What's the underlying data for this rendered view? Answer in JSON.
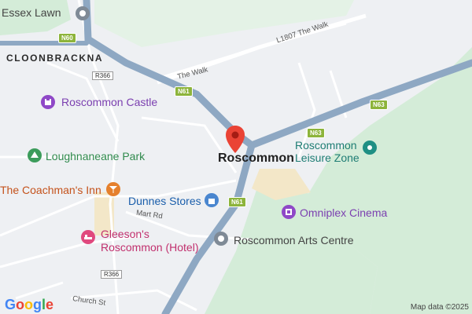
{
  "labels": {
    "essex_lawn": "Essex Lawn",
    "cloonbrackna": "CLOONBRACKNA",
    "roscommon_castle": "Roscommon Castle",
    "loughnaneane_park": "Loughnaneane Park",
    "coachmans_inn": "The Coachman's Inn",
    "dunnes_stores": "Dunnes Stores",
    "mart_rd": "Mart Rd",
    "gleesons_line1": "Gleeson's",
    "gleesons_line2": "Roscommon (Hotel)",
    "church_st": "Church St",
    "roscommon": "Roscommon",
    "leisure_line1": "Roscommon",
    "leisure_line2": "Leisure Zone",
    "omniplex": "Omniplex Cinema",
    "arts_centre": "Roscommon Arts Centre",
    "the_walk_1": "The Walk",
    "l1807": "L1807 The Walk"
  },
  "shields": {
    "n60": "N60",
    "n61_a": "N61",
    "n61_b": "N61",
    "n63_a": "N63",
    "n63_b": "N63",
    "r366_a": "R366",
    "r366_b": "R366"
  },
  "google_logo": [
    "G",
    "o",
    "o",
    "g",
    "l",
    "e"
  ],
  "attribution": "Map data ©2025",
  "colors": {
    "background": "#eef0f3",
    "green_area": "#d4ecd8",
    "highway": "#8ea8c3",
    "marker": "#ea4335"
  }
}
